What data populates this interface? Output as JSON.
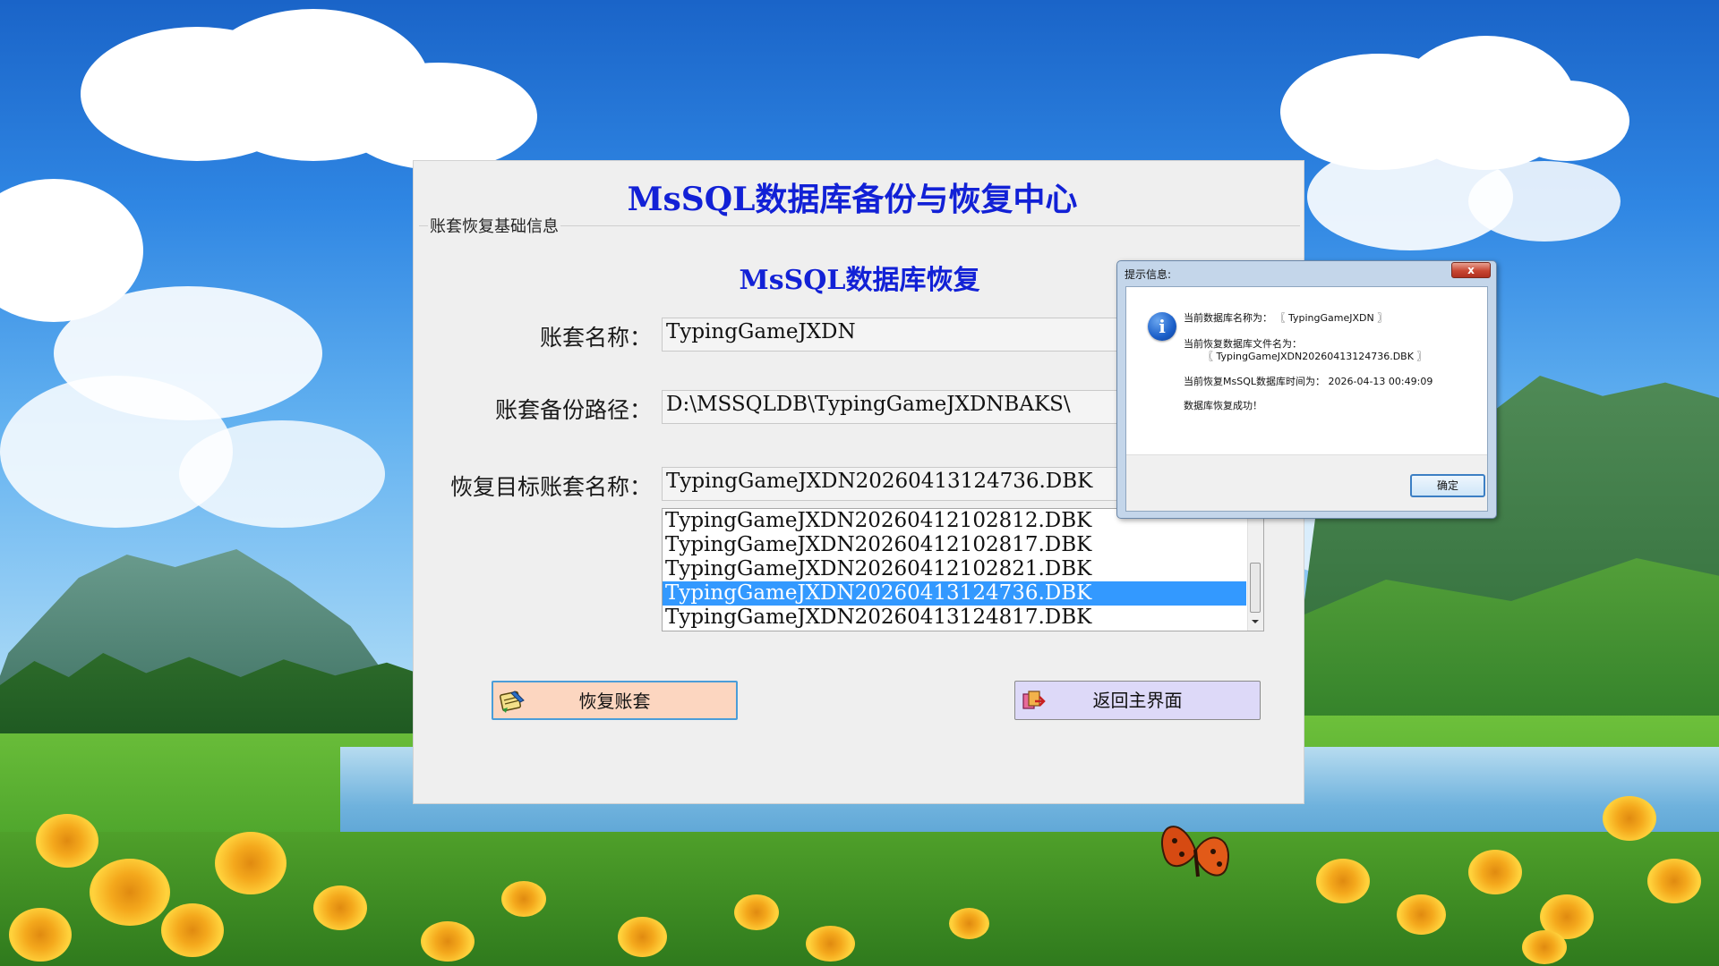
{
  "app": {
    "title": "MsSQL数据库备份与恢复中心",
    "group_label": "账套恢复基础信息",
    "subtitle": "MsSQL数据库恢复"
  },
  "form": {
    "account_name_label": "账套名称：",
    "account_name_value": "TypingGameJXDN",
    "backup_path_label": "账套备份路径：",
    "backup_path_value": "D:\\MSSQLDB\\TypingGameJXDNBAKS\\",
    "target_label": "恢复目标账套名称：",
    "target_value": "TypingGameJXDN20260413124736.DBK"
  },
  "backup_list": {
    "items": [
      "TypingGameJXDN20260412102812.DBK",
      "TypingGameJXDN20260412102817.DBK",
      "TypingGameJXDN20260412102821.DBK",
      "TypingGameJXDN20260413124736.DBK",
      "TypingGameJXDN20260413124817.DBK"
    ],
    "selected_index": 3
  },
  "buttons": {
    "restore": "恢复账套",
    "return_main": "返回主界面"
  },
  "dialog": {
    "title": "提示信息:",
    "close": "x",
    "line1": "当前数据库名称为：  〖 TypingGameJXDN 〗",
    "line2": "当前恢复数据库文件名为：",
    "line3": "〖 TypingGameJXDN20260413124736.DBK 〗",
    "line4": "当前恢复MsSQL数据库时间为：   2026-04-13 00:49:09",
    "line5": "数据库恢复成功！",
    "ok": "确定",
    "icon": "info-icon"
  },
  "colors": {
    "title_blue": "#1221d6",
    "selection": "#3399ff",
    "restore_button": "#fcd6c0",
    "return_button": "#ddd9f8"
  }
}
